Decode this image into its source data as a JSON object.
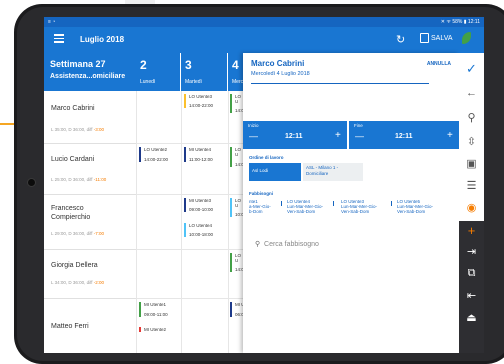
{
  "status": {
    "left": "≡ ◔",
    "right": "✕ ᯤ 58% ▮ 12:11"
  },
  "appbar": {
    "title": "Luglio 2018",
    "save_label": "SALVA"
  },
  "week": {
    "title": "Settimana 27",
    "subtitle": "Assistenza...omiciliare"
  },
  "days": [
    {
      "num": "2",
      "name": "Lunedì"
    },
    {
      "num": "3",
      "name": "Martedì"
    },
    {
      "num": "4",
      "name": "Merc"
    }
  ],
  "people": [
    {
      "name": "Marco Cabrini",
      "meta_a": "L 35:00, D 36:00, diff ",
      "meta_diff": "-3:00"
    },
    {
      "name": "Lucio Cardani",
      "meta_a": "L 25:00, D 36:00, diff ",
      "meta_diff": "-11:00"
    },
    {
      "name": "Francesco\nCompierchio",
      "meta_a": "L 29:00, D 36:00, diff ",
      "meta_diff": "-7:00"
    },
    {
      "name": "Giorgia Dellera",
      "meta_a": "L 34:00, D 36:00, diff ",
      "meta_diff": "-2:00"
    },
    {
      "name": "Matteo Ferri",
      "meta_a": "",
      "meta_diff": ""
    }
  ],
  "shifts": {
    "r0d1": {
      "a": "LO Utente3",
      "b": "14:00-22:00"
    },
    "r0d2": {
      "a": "LO U",
      "b": "14:0"
    },
    "r1d0": {
      "a": "LO Utente2",
      "b": "14:00-22:00"
    },
    "r1d1": {
      "a": "MI Utente4",
      "b": "11:00-12:00"
    },
    "r1d2": {
      "a": "LO U",
      "b": "14:0"
    },
    "r2d1a": {
      "a": "MI Utente3",
      "b": "09:00-10:00"
    },
    "r2d1b": {
      "a": "LO Utente4",
      "b": "10:00-18:00"
    },
    "r2d2": {
      "a": "LO U",
      "b": "10:0"
    },
    "r3d2": {
      "a": "LO U",
      "b": "14:0"
    },
    "r4d0a": {
      "a": "MI Utente1",
      "b": "09:00-11:00"
    },
    "r4d0b": {
      "a": "MI Utente2",
      "b": ""
    },
    "r4d2": {
      "a": "MI U",
      "b": "06:0"
    }
  },
  "panel": {
    "title": "Marco Cabrini",
    "date": "Mercoledì 4 Luglio 2018",
    "cancel": "ANNULLA",
    "start_label": "Inizio",
    "start_value": "12:11",
    "end_label": "Fine",
    "end_value": "12:11",
    "work_label": "Ordine di lavoro",
    "work_options": [
      "Asl Lodi",
      "ASL - Milano 1 -\nDomiciliare"
    ],
    "needs_label": "Fabbisogni",
    "needs": [
      {
        "title": "nte1",
        "days": "a-Mer-Gio-\nb-Dom"
      },
      {
        "title": "LO Utente4",
        "days": "Lun-Mar-Mer-Gio-\nVen-Sab-Dom"
      },
      {
        "title": "LO Utente3",
        "days": "Lun-Mar-Mer-Gio-\nVen-Sab-Dom"
      },
      {
        "title": "LO Utente5",
        "days": "Lun-Mar-Mer-Gio-\nVen-Sab-Dom"
      }
    ],
    "search_placeholder": "Cerca fabbisogno"
  },
  "colors": {
    "primary": "#1976d2",
    "dark": "#1565c0",
    "accent_orange": "#f57c00",
    "green": "#43a047"
  },
  "rail_icons": [
    "check-icon",
    "arrow-left-icon",
    "search-icon",
    "sort-icon",
    "image-icon",
    "list-icon",
    "eye-icon",
    "plus-icon",
    "login-icon",
    "copy-icon",
    "logout-icon",
    "exit-icon"
  ]
}
